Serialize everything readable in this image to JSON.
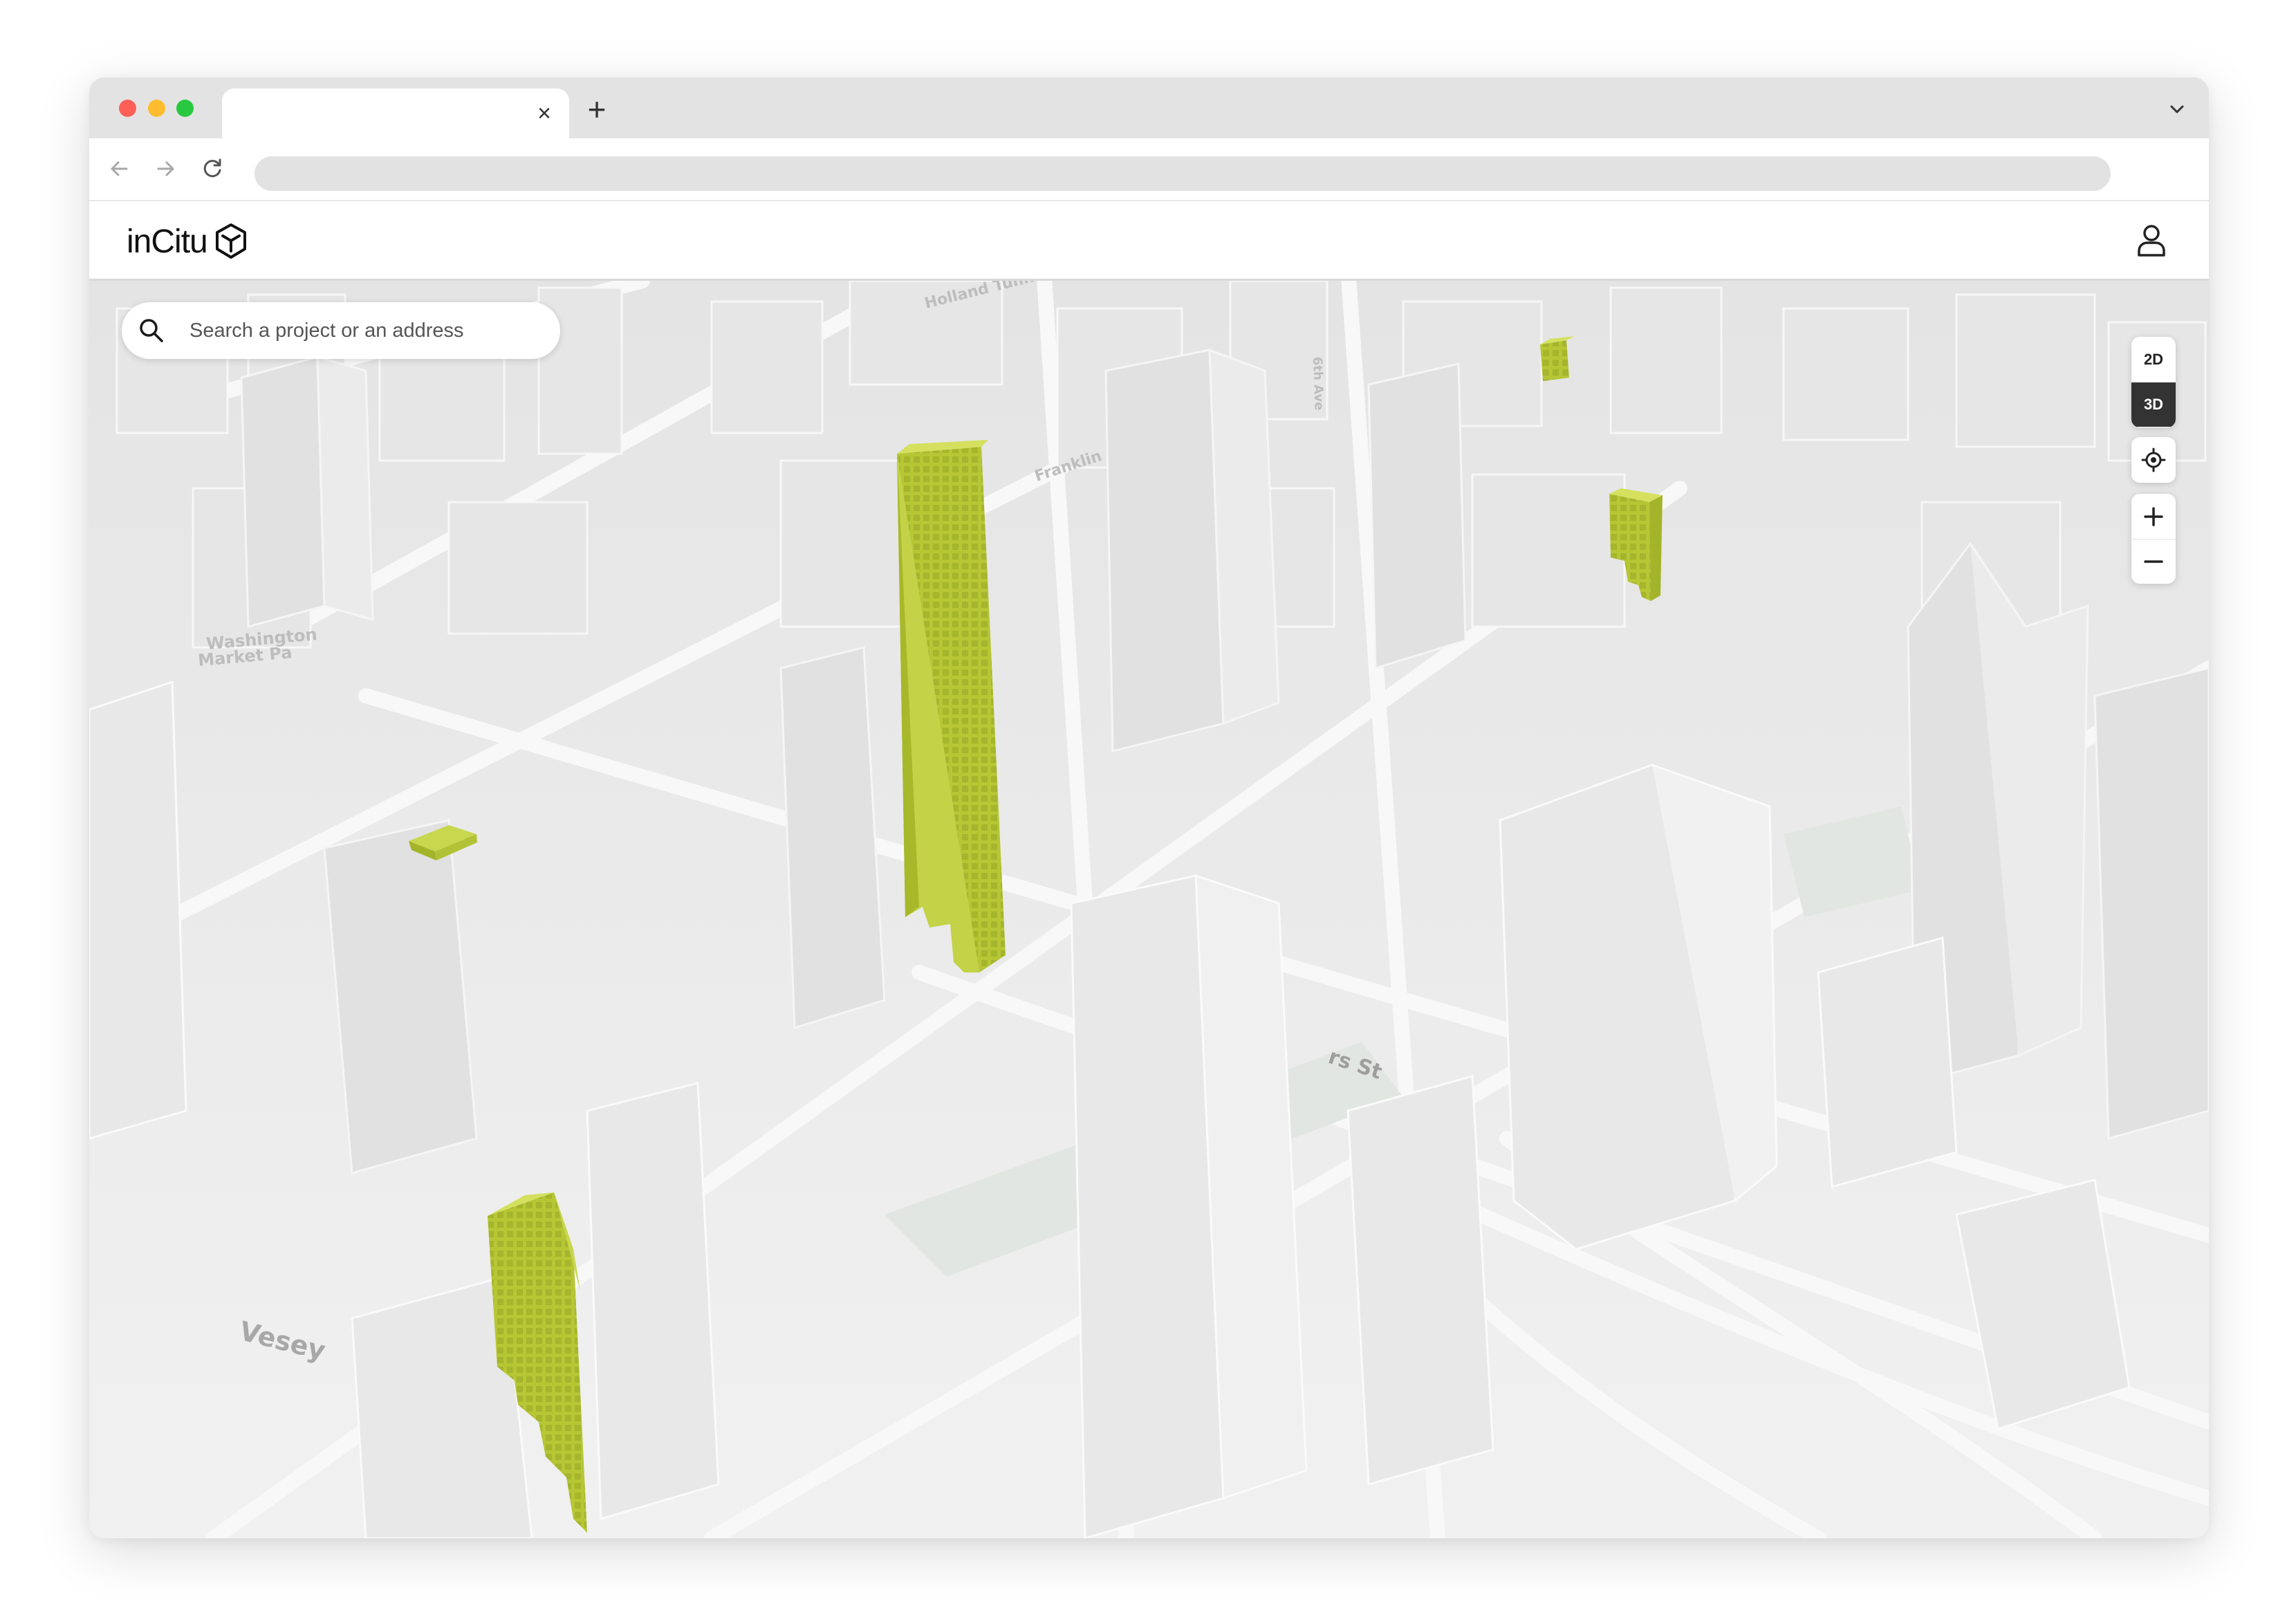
{
  "browser": {
    "tab_title": "",
    "tab_close_glyph": "×",
    "new_tab_glyph": "+",
    "url": ""
  },
  "app": {
    "logo_text": "inCitu",
    "logo_icon": "cube-icon",
    "user_icon": "user-icon"
  },
  "search": {
    "placeholder": "Search a project or an address",
    "value": "",
    "icon": "search-icon"
  },
  "view_toggle": {
    "options": [
      "2D",
      "3D"
    ],
    "selected": "3D"
  },
  "map_controls": {
    "locate_icon": "crosshair-icon",
    "zoom_in_glyph": "+",
    "zoom_out_glyph": "−"
  },
  "map": {
    "labels": [
      {
        "name": "map-label-holland-tunnel",
        "text": "Holland Tunnel"
      },
      {
        "name": "map-label-washington-market-park-1",
        "text": "Washington"
      },
      {
        "name": "map-label-washington-market-park-2",
        "text": "Market Pa"
      },
      {
        "name": "map-label-franklin",
        "text": "Franklin"
      },
      {
        "name": "map-label-6th-ave",
        "text": "6th Ave"
      },
      {
        "name": "map-label-chambers-st",
        "text": "rs St"
      },
      {
        "name": "map-label-vesey",
        "text": "Vesey"
      }
    ],
    "highlight_color": "#b4c634",
    "base_color": "#eeeeee"
  }
}
